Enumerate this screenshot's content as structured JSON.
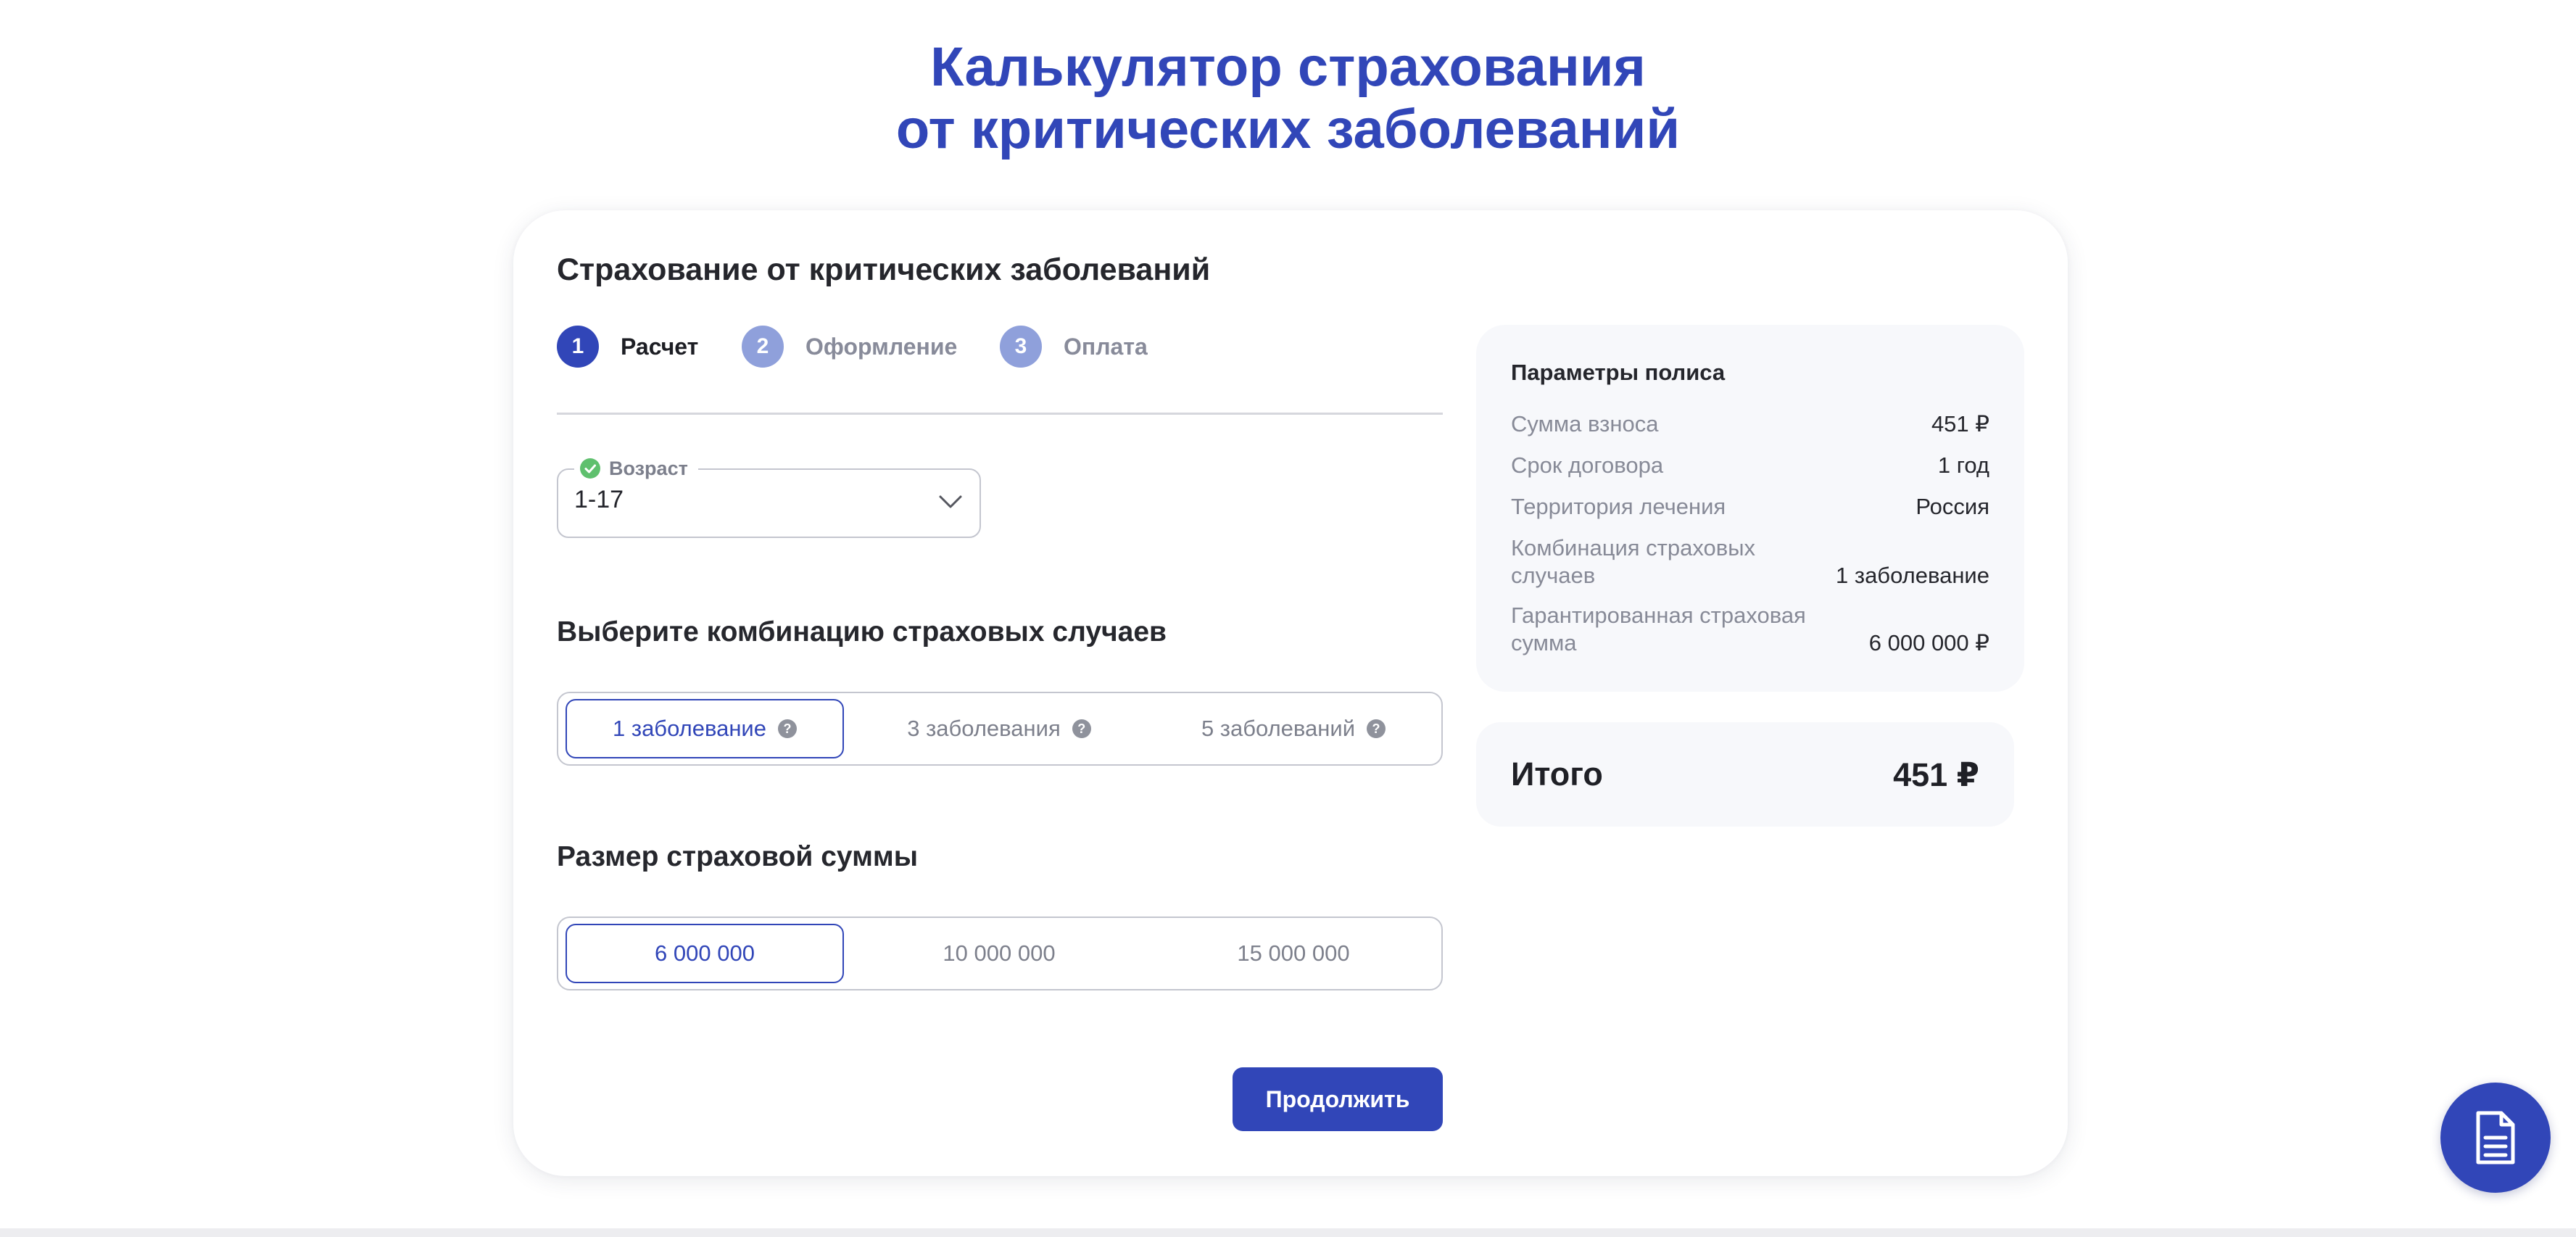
{
  "page": {
    "title_line1": "Калькулятор страхования",
    "title_line2": "от критических заболеваний"
  },
  "form": {
    "title": "Страхование от критических заболеваний",
    "steps": [
      {
        "number": "1",
        "label": "Расчет",
        "state": "active"
      },
      {
        "number": "2",
        "label": "Оформление",
        "state": "inactive"
      },
      {
        "number": "3",
        "label": "Оплата",
        "state": "inactive"
      }
    ],
    "age": {
      "label": "Возраст",
      "value": "1-17"
    },
    "combination": {
      "heading": "Выберите комбинацию страховых случаев",
      "options": [
        "1 заболевание",
        "3 заболевания",
        "5 заболеваний"
      ],
      "selected_index": 0
    },
    "sum": {
      "heading": "Размер страховой суммы",
      "options": [
        "6 000 000",
        "10 000 000",
        "15 000 000"
      ],
      "selected_index": 0
    },
    "continue_label": "Продолжить"
  },
  "policy": {
    "title": "Параметры полиса",
    "rows": [
      {
        "label": "Сумма взноса",
        "value": "451 ₽"
      },
      {
        "label": "Срок договора",
        "value": "1 год"
      },
      {
        "label": "Территория лечения",
        "value": "Россия"
      },
      {
        "label_line1": "Комбинация страховых",
        "label_line2": "случаев",
        "value": "1 заболевание"
      },
      {
        "label_line1": "Гарантированная страховая",
        "label_line2": "сумма",
        "value": "6 000 000 ₽"
      }
    ]
  },
  "total": {
    "label": "Итого",
    "value": "451 ₽"
  },
  "colors": {
    "accent": "#3146b8",
    "step_inactive": "#8fa0db",
    "success": "#5fc06e",
    "panel_bg": "#f7f8fb"
  },
  "icons": {
    "age_status": "check-circle-icon",
    "select": "chevron-down-icon",
    "help": "question-icon",
    "fab": "document-icon"
  }
}
